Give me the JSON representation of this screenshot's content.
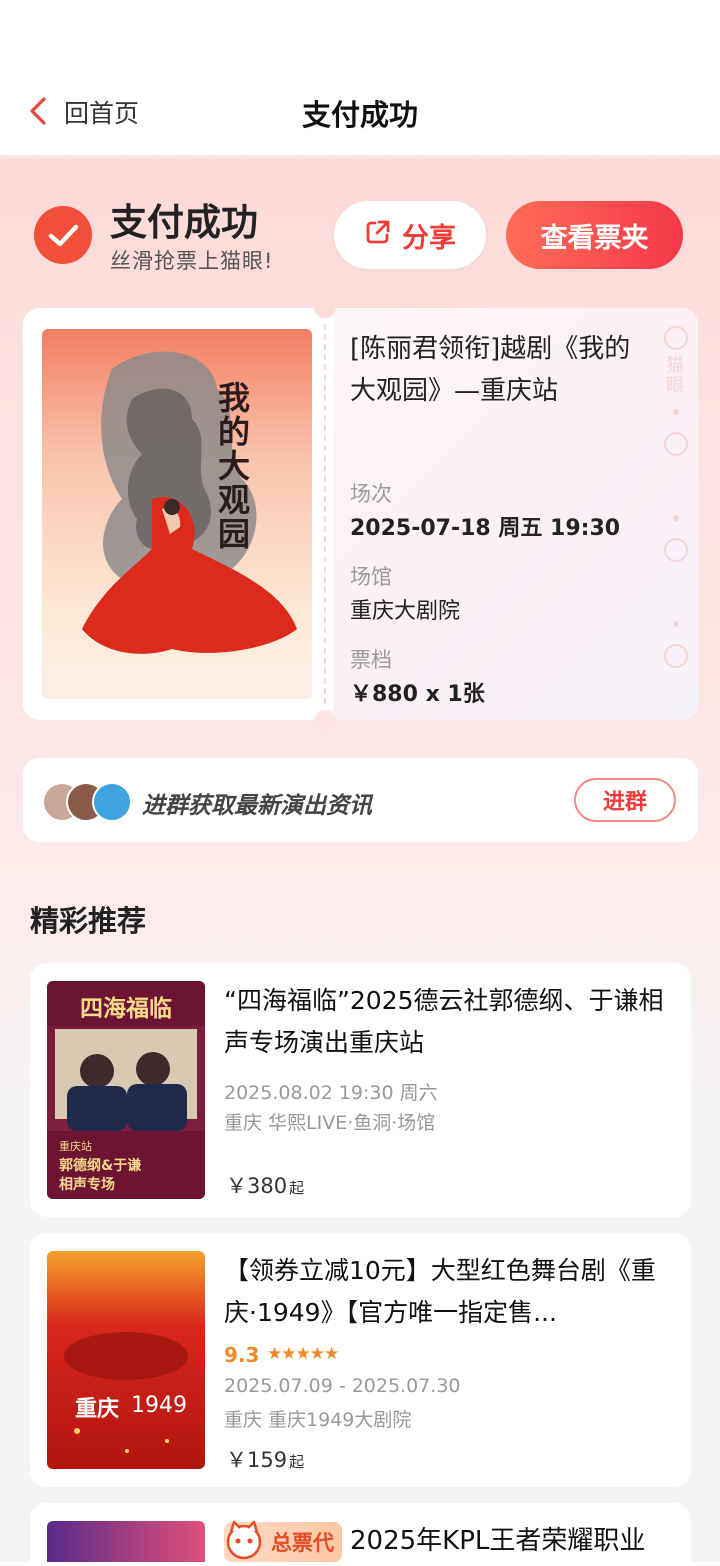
{
  "nav": {
    "back_label": "回首页",
    "title": "支付成功"
  },
  "success": {
    "title": "支付成功",
    "subtitle": "丝滑抢票上猫眼!",
    "share_label": "分享",
    "view_tickets_label": "查看票夹"
  },
  "ticket": {
    "title": "[陈丽君领衔]越剧《我的大观园》—重庆站",
    "poster_text": "我的大观园",
    "session_label": "场次",
    "session_value": "2025-07-18 周五 19:30",
    "venue_label": "场馆",
    "venue_value": "重庆大剧院",
    "tier_label": "票档",
    "tier_value": "￥880 x 1张",
    "watermark_text": "猫眼"
  },
  "group": {
    "text": "进群获取最新演出资讯",
    "join_label": "进群"
  },
  "recommend": {
    "heading": "精彩推荐",
    "items": [
      {
        "title": "“四海福临”2025德云社郭德纲、于谦相声专场演出重庆站",
        "date": "2025.08.02 19:30 周六",
        "venue": "重庆 华熙LIVE·鱼洞·场馆",
        "price": "￥380",
        "price_suffix": "起",
        "poster_title": "四海福临",
        "poster_sub1": "重庆站",
        "poster_sub2": "郭德纲&于谦",
        "poster_sub3": "相声专场"
      },
      {
        "title": "【领券立减10元】大型红色舞台剧《重庆·1949》【官方唯一指定售...",
        "rating": "9.3",
        "stars": "★★★★★",
        "date": "2025.07.09 - 2025.07.30",
        "venue": "重庆 重庆1949大剧院",
        "price": "￥159",
        "price_suffix": "起",
        "poster_title": "重庆",
        "poster_year": "1949"
      },
      {
        "badge": "总票代",
        "title": "2025年KPL王者荣耀职业"
      }
    ]
  },
  "colors": {
    "accent": "#f03d3a",
    "gradient_start": "#ff6d57",
    "gradient_end": "#f4384a",
    "rating": "#f08a24"
  }
}
